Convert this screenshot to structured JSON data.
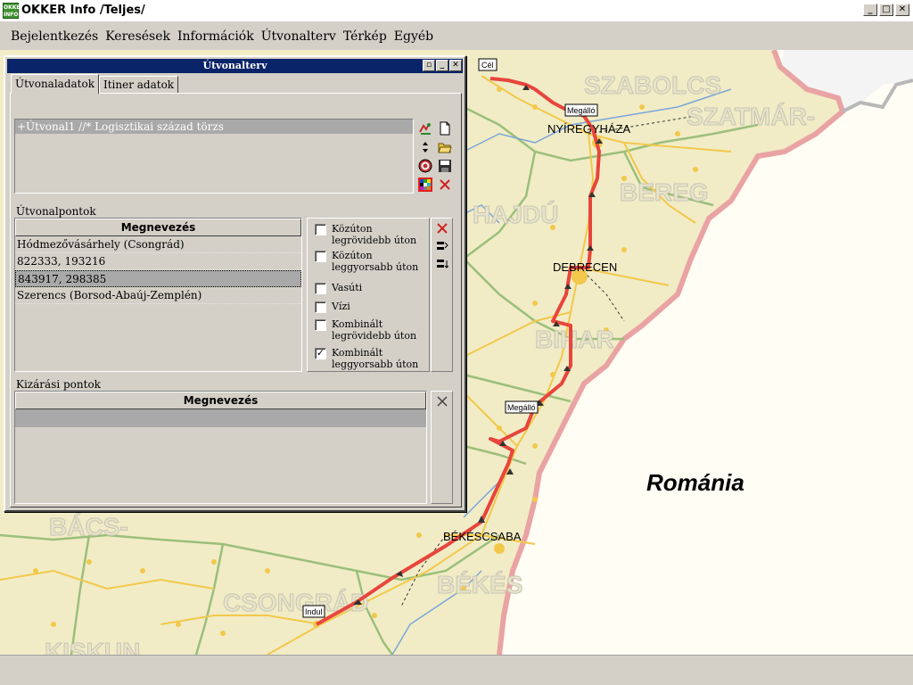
{
  "app": {
    "title": "OKKER Info /Teljes/",
    "icon_text": "OKKER INFO",
    "window_buttons": [
      "_",
      "□",
      "✕"
    ]
  },
  "menu": [
    {
      "label": "Bejelentkezés"
    },
    {
      "label": "Keresések"
    },
    {
      "label": "Információk"
    },
    {
      "label": "Útvonalterv"
    },
    {
      "label": "Térkép"
    },
    {
      "label": "Egyéb"
    }
  ],
  "route_window": {
    "title": "Útvonalterv",
    "tabs": [
      {
        "label": "Útvonaladatok",
        "active": true
      },
      {
        "label": "Itiner adatok",
        "active": false
      }
    ],
    "routes": [
      {
        "label": "+Útvonal1 //* Logisztikai század törzs",
        "selected": true
      }
    ],
    "route_icons": [
      "route-new-icon",
      "document-icon",
      "move-up-down-icon",
      "open-folder-icon",
      "target-icon",
      "save-disk-icon",
      "color-palette-icon",
      "delete-icon"
    ],
    "waypoints_label": "Útvonalpontok",
    "waypoints_header": "Megnevezés",
    "waypoints": [
      {
        "name": "Hódmezővásárhely (Csongrád)",
        "selected": false
      },
      {
        "name": "822333, 193216",
        "selected": false
      },
      {
        "name": "843917, 298385",
        "selected": true
      },
      {
        "name": "Szerencs (Borsod-Abaúj-Zemplén)",
        "selected": false
      }
    ],
    "route_modes": [
      {
        "label": "Közúton legrövidebb úton",
        "checked": false
      },
      {
        "label": "Közúton leggyorsabb úton",
        "checked": false
      },
      {
        "label": "Vasúti",
        "checked": false
      },
      {
        "label": "Vízi",
        "checked": false
      },
      {
        "label": "Kombinált legrövidebb úton",
        "checked": false
      },
      {
        "label": "Kombinált leggyorsabb úton",
        "checked": true
      }
    ],
    "exclusion_label": "Kizárási pontok",
    "exclusion_header": "Megnevezés"
  },
  "map": {
    "cities": [
      "NYÍREGYHÁZA",
      "DEBRECEN",
      "BÉKÉSCSABA"
    ],
    "regions": [
      "SZABOLCS",
      "SZATMÁR-",
      "BEREG",
      "HAJDÚ",
      "BIHAR",
      "BÁCS-",
      "CSONGRÁD",
      "BÉKÉS",
      "KISKUN"
    ],
    "country": "Románia",
    "markers": {
      "start": "Indul",
      "stop1": "Megálló",
      "stop2": "Megálló",
      "end": "Cél"
    },
    "colors": {
      "route": "#e8453c",
      "border": "#e9a3a3",
      "roads": "#f2c84b",
      "rivers": "#7aa5d8",
      "county": "#9bbf7a",
      "land": "#f1ecc6",
      "romania": "#fffdf4"
    }
  }
}
